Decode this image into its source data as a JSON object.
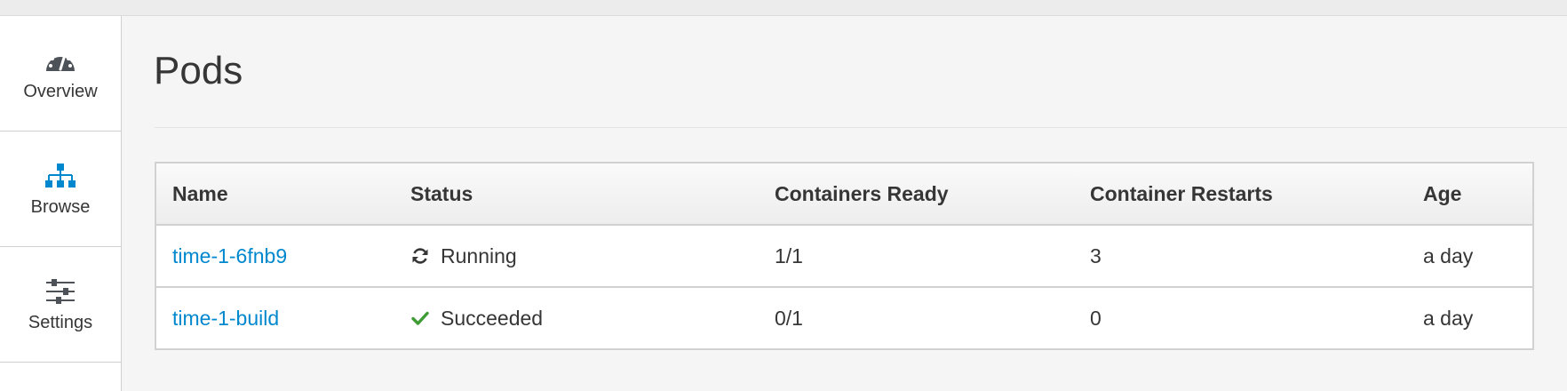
{
  "sidebar": {
    "items": [
      {
        "label": "Overview",
        "icon": "dashboard-icon"
      },
      {
        "label": "Browse",
        "icon": "sitemap-icon",
        "color": "#0088ce"
      },
      {
        "label": "Settings",
        "icon": "sliders-icon"
      }
    ]
  },
  "page": {
    "title": "Pods"
  },
  "table": {
    "headers": [
      "Name",
      "Status",
      "Containers Ready",
      "Container Restarts",
      "Age"
    ],
    "rows": [
      {
        "name": "time-1-6fnb9",
        "status": "Running",
        "status_icon": "refresh-icon",
        "ready": "1/1",
        "restarts": "3",
        "age": "a day"
      },
      {
        "name": "time-1-build",
        "status": "Succeeded",
        "status_icon": "check-icon",
        "status_color": "#3f9c35",
        "ready": "0/1",
        "restarts": "0",
        "age": "a day"
      }
    ]
  },
  "colors": {
    "link": "#0088ce",
    "success": "#3f9c35",
    "text": "#363636"
  }
}
